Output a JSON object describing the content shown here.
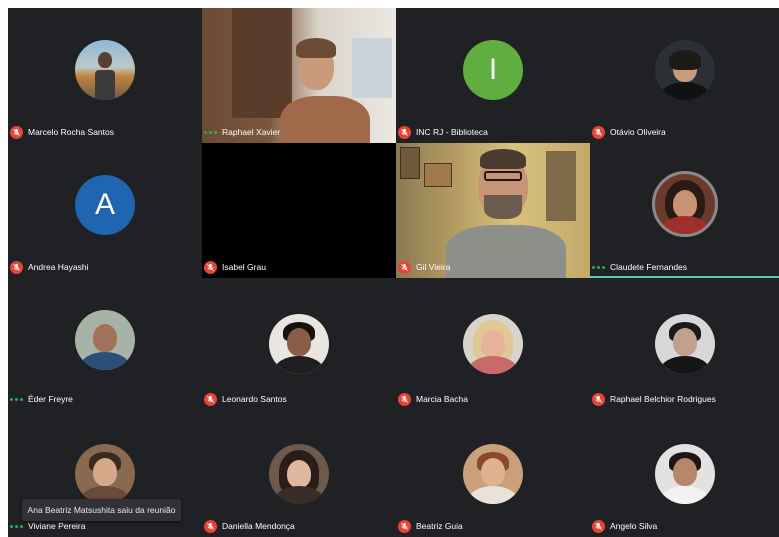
{
  "participants": [
    {
      "name": "Marcelo Rocha Santos",
      "status": "muted"
    },
    {
      "name": "Raphael Xavier",
      "status": "speaking"
    },
    {
      "name": "INC RJ - Biblioteca",
      "status": "muted",
      "initial": "I",
      "avatar_color": "#5fae3f"
    },
    {
      "name": "Otávio Oliveira",
      "status": "muted"
    },
    {
      "name": "Andrea Hayashi",
      "status": "muted",
      "initial": "A",
      "avatar_color": "#1f65b0"
    },
    {
      "name": "Isabel Grau",
      "status": "muted"
    },
    {
      "name": "Gil Vieira",
      "status": "muted"
    },
    {
      "name": "Claudete Fernandes",
      "status": "speaking"
    },
    {
      "name": "Éder Freyre",
      "status": "speaking"
    },
    {
      "name": "Leonardo Santos",
      "status": "muted"
    },
    {
      "name": "Marcia Bacha",
      "status": "muted"
    },
    {
      "name": "Raphael Belchior Rodrigues",
      "status": "muted"
    },
    {
      "name": "Viviane Pereira",
      "status": "speaking"
    },
    {
      "name": "Daniella Mendonça",
      "status": "muted"
    },
    {
      "name": "Beatriz Guia",
      "status": "muted"
    },
    {
      "name": "Angelo Silva",
      "status": "muted"
    }
  ],
  "notification": {
    "text": "Ana Beatriz Matsushita saiu da reunião"
  },
  "colors": {
    "background": "#202124",
    "muted_icon": "#ea4335",
    "speaking_dots": "#34a853",
    "active_speaker_bar": "#5bc8b8"
  },
  "icons": {
    "muted": "mic-off-icon",
    "speaking": "audio-dots-icon"
  }
}
